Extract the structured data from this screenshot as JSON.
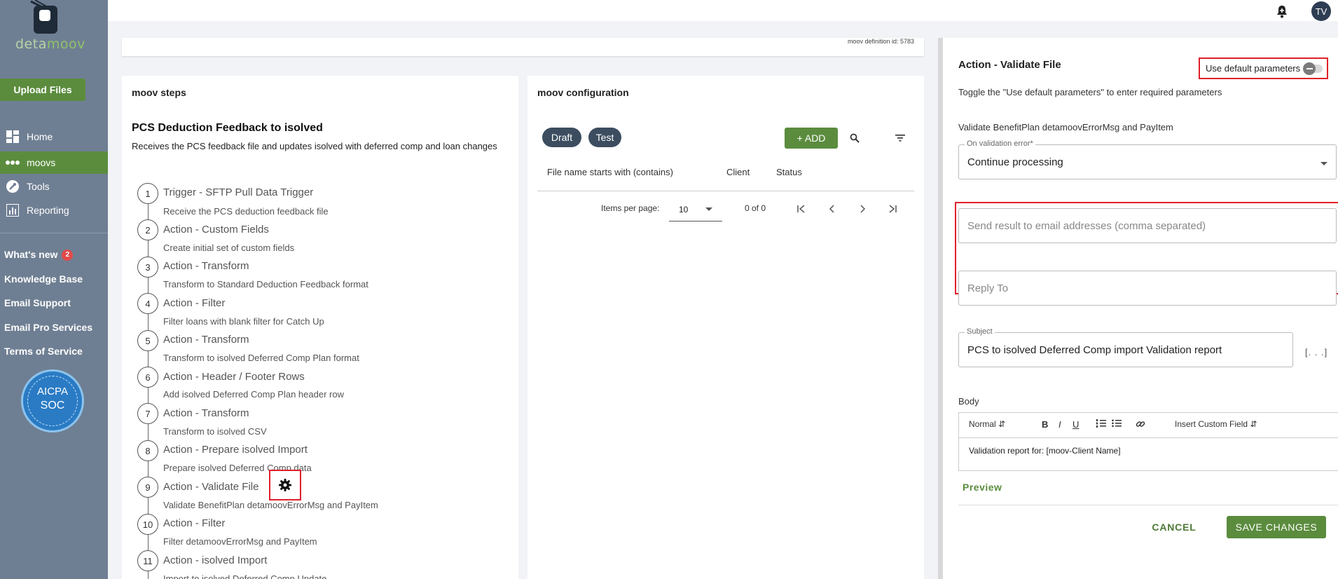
{
  "app": {
    "logo_text_a": "deta",
    "logo_text_b": "moov",
    "upload_label": "Upload Files",
    "nav": [
      {
        "label": "Home"
      },
      {
        "label": "moovs"
      },
      {
        "label": "Tools"
      },
      {
        "label": "Reporting"
      }
    ],
    "links": {
      "whats_new": "What's new",
      "whats_new_badge": "2",
      "knowledge_base": "Knowledge Base",
      "email_support": "Email Support",
      "email_pro": "Email Pro Services",
      "terms": "Terms of Service"
    },
    "aicpa_line1": "AICPA",
    "aicpa_line2": "SOC",
    "avatar_initials": "TV",
    "accent_color": "#5b8c3e",
    "sidebar_color": "#6f7f93"
  },
  "header": {
    "definition_id": "moov definition id: 5783"
  },
  "steps_panel": {
    "title": "moov steps",
    "moov_name": "PCS Deduction Feedback to isolved",
    "moov_desc": "Receives the PCS feedback file and updates isolved with deferred comp and loan changes",
    "steps": [
      {
        "num": "1",
        "title": "Trigger - SFTP Pull Data Trigger",
        "desc": "Receive the PCS deduction feedback file"
      },
      {
        "num": "2",
        "title": "Action - Custom Fields",
        "desc": "Create initial set of custom fields"
      },
      {
        "num": "3",
        "title": "Action - Transform",
        "desc": "Transform to Standard Deduction Feedback format"
      },
      {
        "num": "4",
        "title": "Action - Filter",
        "desc": "Filter loans with blank filter for Catch Up"
      },
      {
        "num": "5",
        "title": "Action - Transform",
        "desc": "Transform to isolved Deferred Comp Plan format"
      },
      {
        "num": "6",
        "title": "Action - Header / Footer Rows",
        "desc": "Add isolved Deferred Comp Plan header row"
      },
      {
        "num": "7",
        "title": "Action - Transform",
        "desc": "Transform to isolved CSV"
      },
      {
        "num": "8",
        "title": "Action - Prepare isolved Import",
        "desc": "Prepare isolved Deferred Comp data"
      },
      {
        "num": "9",
        "title": "Action - Validate File",
        "desc": "Validate BenefitPlan detamoovErrorMsg and PayItem"
      },
      {
        "num": "10",
        "title": "Action - Filter",
        "desc": "Filter detamoovErrorMsg and PayItem"
      },
      {
        "num": "11",
        "title": "Action - isolved Import",
        "desc": "Import to isolved Deferred Comp Update"
      }
    ]
  },
  "config_panel": {
    "title": "moov configuration",
    "chip_draft": "Draft",
    "chip_test": "Test",
    "add_label": "+ ADD",
    "columns": [
      "File name starts with (contains)",
      "Client",
      "Status"
    ],
    "items_per_page_label": "Items per page:",
    "items_per_page": "10",
    "range": "0 of 0"
  },
  "drawer": {
    "title": "Action - Validate File",
    "use_default_label": "Use default parameters",
    "toggle_hint": "Toggle the \"Use default parameters\" to enter required parameters",
    "validate_text": "Validate BenefitPlan detamoovErrorMsg and PayItem",
    "on_error_label": "On validation error*",
    "on_error_value": "Continue processing",
    "email_placeholder": "Send result to email addresses (comma separated)",
    "reply_placeholder": "Reply To",
    "subject_label": "Subject",
    "subject_value": "PCS to isolved Deferred Comp import Validation report",
    "ellipsis": "[. . .]",
    "body_label": "Body",
    "toolbar_style": "Normal",
    "toolbar_custom_field": "Insert Custom Field",
    "body_text": "Validation report for: [moov-Client Name]",
    "preview_label": "Preview",
    "cancel_label": "CANCEL",
    "save_label": "SAVE CHANGES"
  }
}
